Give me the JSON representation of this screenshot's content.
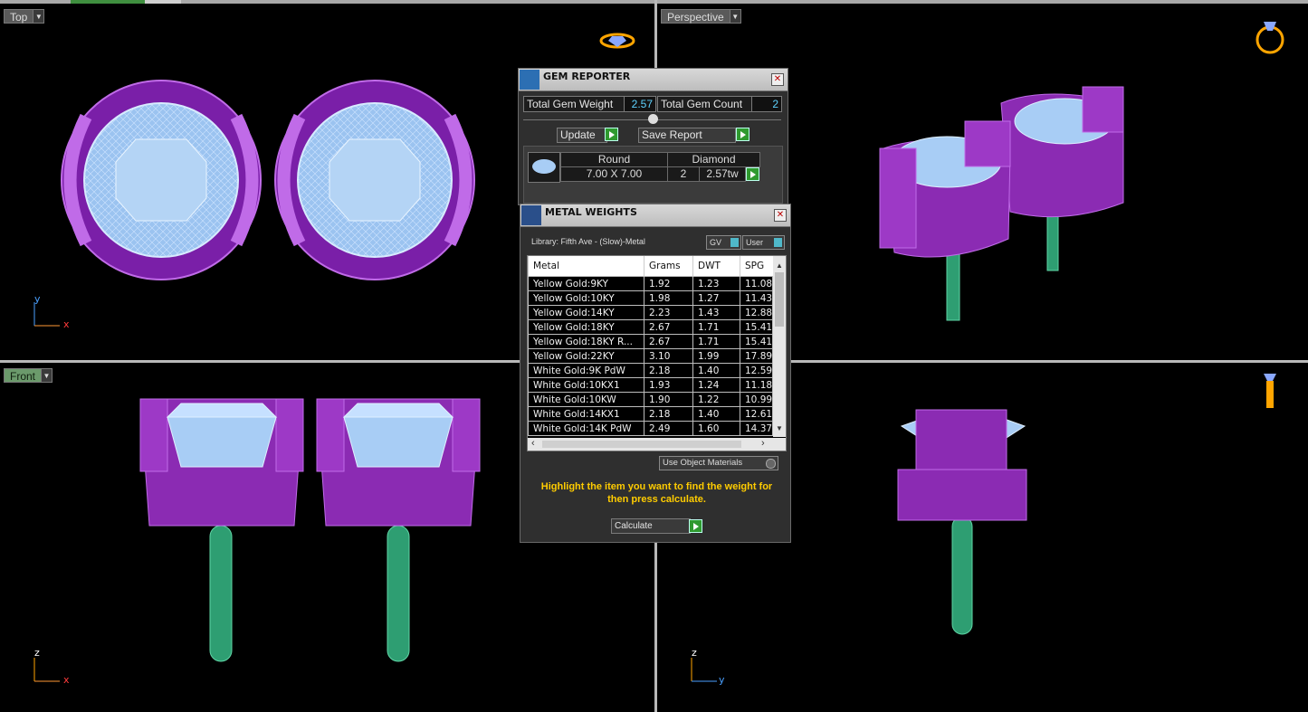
{
  "viewports": {
    "top": {
      "label": "Top",
      "axis_a": "y",
      "axis_b": "x"
    },
    "perspective": {
      "label": "Perspective"
    },
    "front": {
      "label": "Front",
      "axis_a": "z",
      "axis_b": "x"
    },
    "side": {
      "axis_a": "z",
      "axis_b": "y"
    }
  },
  "gem_reporter": {
    "title": "GEM REPORTER",
    "total_weight_label": "Total Gem Weight",
    "total_weight_value": "2.57",
    "total_count_label": "Total Gem Count",
    "total_count_value": "2",
    "update_label": "Update",
    "save_report_label": "Save Report",
    "gem": {
      "shape": "Round",
      "size": "7.00 X 7.00",
      "material": "Diamond",
      "count": "2",
      "weight": "2.57tw"
    }
  },
  "metal_weights": {
    "title": "METAL WEIGHTS",
    "library": "Library: Fifth Ave - (Slow)-Metal",
    "gv_label": "GV",
    "user_label": "User",
    "columns": [
      "Metal",
      "Grams",
      "DWT",
      "SPG"
    ],
    "rows": [
      [
        "Yellow Gold:9KY",
        "1.92",
        "1.23",
        "11.08"
      ],
      [
        "Yellow Gold:10KY",
        "1.98",
        "1.27",
        "11.43"
      ],
      [
        "Yellow Gold:14KY",
        "2.23",
        "1.43",
        "12.88"
      ],
      [
        "Yellow Gold:18KY",
        "2.67",
        "1.71",
        "15.41"
      ],
      [
        "Yellow Gold:18KY R...",
        "2.67",
        "1.71",
        "15.41"
      ],
      [
        "Yellow Gold:22KY",
        "3.10",
        "1.99",
        "17.89"
      ],
      [
        "White Gold:9K PdW",
        "2.18",
        "1.40",
        "12.59"
      ],
      [
        "White Gold:10KX1",
        "1.93",
        "1.24",
        "11.18"
      ],
      [
        "White Gold:10KW",
        "1.90",
        "1.22",
        "10.99"
      ],
      [
        "White Gold:14KX1",
        "2.18",
        "1.40",
        "12.61"
      ],
      [
        "White Gold:14K PdW",
        "2.49",
        "1.60",
        "14.37"
      ]
    ],
    "use_object_materials": "Use Object Materials",
    "instruction": "Highlight the item you want to find the weight for then press calculate.",
    "calculate_label": "Calculate"
  },
  "icons": [
    "ring-top-icon",
    "ring-perspective-icon",
    "ring-side-icon"
  ],
  "colors": {
    "metal": "#8b2bb3",
    "gem": "#a8cdf5",
    "post": "#2e9e72",
    "panel": "#2f2f2f",
    "value": "#5fd3ff",
    "instruction": "#ffcc00"
  }
}
